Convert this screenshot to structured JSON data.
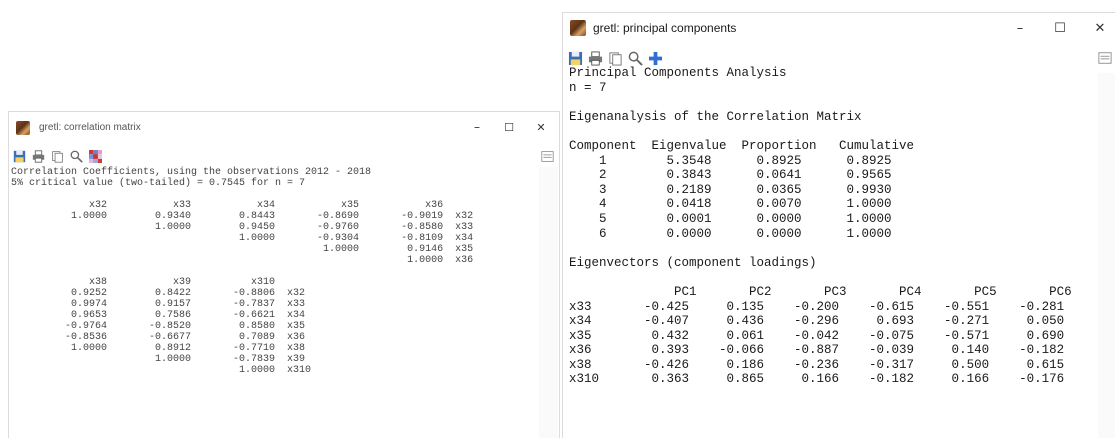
{
  "left_window": {
    "title": "gretl: correlation matrix",
    "controls": {
      "minimize": "–",
      "maximize": "☐",
      "close": "✕"
    },
    "lines": [
      "Correlation Coefficients, using the observations 2012 - 2018",
      "5% critical value (two-tailed) = 0.7545 for n = 7",
      "",
      "             x32           x33           x34           x35           x36",
      "          1.0000        0.9340        0.8443       -0.8690       -0.9019  x32",
      "                        1.0000        0.9450       -0.9760       -0.8580  x33",
      "                                      1.0000       -0.9304       -0.8109  x34",
      "                                                    1.0000        0.9146  x35",
      "                                                                  1.0000  x36",
      "",
      "             x38           x39          x310",
      "          0.9252        0.8422       -0.8806  x32",
      "          0.9974        0.9157       -0.7837  x33",
      "          0.9653        0.7586       -0.6621  x34",
      "         -0.9764       -0.8520        0.8580  x35",
      "         -0.8536       -0.6677        0.7089  x36",
      "          1.0000        0.8912       -0.7710  x38",
      "                        1.0000       -0.7839  x39",
      "                                      1.0000  x310"
    ]
  },
  "right_window": {
    "title": "gretl: principal components",
    "controls": {
      "minimize": "–",
      "maximize": "☐",
      "close": "✕"
    },
    "lines": [
      "Principal Components Analysis",
      "n = 7",
      "",
      "Eigenanalysis of the Correlation Matrix",
      "",
      "Component  Eigenvalue  Proportion   Cumulative",
      "    1        5.3548      0.8925      0.8925",
      "    2        0.3843      0.0641      0.9565",
      "    3        0.2189      0.0365      0.9930",
      "    4        0.0418      0.0070      1.0000",
      "    5        0.0001      0.0000      1.0000",
      "    6        0.0000      0.0000      1.0000",
      "",
      "Eigenvectors (component loadings)",
      "",
      "              PC1       PC2       PC3       PC4       PC5       PC6",
      "x33       -0.425     0.135    -0.200    -0.615    -0.551    -0.281",
      "x34       -0.407     0.436    -0.296     0.693    -0.271     0.050",
      "x35        0.432     0.061    -0.042    -0.075    -0.571     0.690",
      "x36        0.393    -0.066    -0.887    -0.039     0.140    -0.182",
      "x38       -0.426     0.186    -0.236    -0.317     0.500     0.615",
      "x310       0.363     0.865     0.166    -0.182     0.166    -0.176"
    ]
  }
}
